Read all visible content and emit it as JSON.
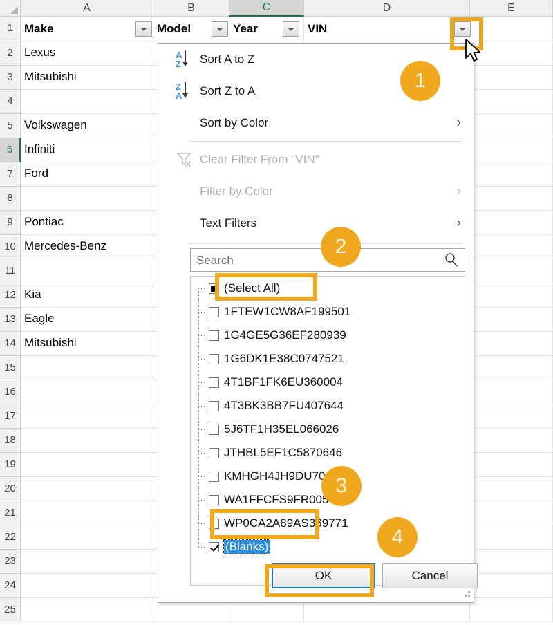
{
  "grid": {
    "columns": [
      "A",
      "B",
      "C",
      "D",
      "E"
    ],
    "active_column": "C",
    "active_row": 6,
    "row_numbers": [
      1,
      2,
      3,
      4,
      5,
      6,
      7,
      8,
      9,
      10,
      11,
      12,
      13,
      14,
      15,
      16,
      17,
      18,
      19,
      20,
      21,
      22,
      23,
      24,
      25
    ],
    "headers": {
      "a": "Make",
      "b": "Model",
      "c": "Year",
      "d": "VIN"
    },
    "column_a_values": [
      "Lexus",
      "Mitsubishi",
      "",
      "Volkswagen",
      "Infiniti",
      "Ford",
      "",
      "Pontiac",
      "Mercedes-Benz",
      "",
      "Kia",
      "Eagle",
      "Mitsubishi"
    ]
  },
  "filter_menu": {
    "sort_a_to_z": "Sort A to Z",
    "sort_z_to_a": "Sort Z to A",
    "sort_by_color": "Sort by Color",
    "clear_filter": "Clear Filter From \"VIN\"",
    "filter_by_color": "Filter by Color",
    "text_filters": "Text Filters",
    "submenu_arrow": "›",
    "search": {
      "placeholder": "Search",
      "value": "",
      "icon": "search-icon"
    },
    "list": [
      {
        "label": "(Select All)",
        "state": "partial",
        "selected": false
      },
      {
        "label": "1FTEW1CW8AF199501",
        "state": "unchecked",
        "selected": false
      },
      {
        "label": "1G4GE5G36EF280939",
        "state": "unchecked",
        "selected": false
      },
      {
        "label": "1G6DK1E38C0747521",
        "state": "unchecked",
        "selected": false
      },
      {
        "label": "4T1BF1FK6EU360004",
        "state": "unchecked",
        "selected": false
      },
      {
        "label": "4T3BK3BB7FU407644",
        "state": "unchecked",
        "selected": false
      },
      {
        "label": "5J6TF1H35EL066026",
        "state": "unchecked",
        "selected": false
      },
      {
        "label": "JTHBL5EF1C5870646",
        "state": "unchecked",
        "selected": false
      },
      {
        "label": "KMHGH4JH9DU700878",
        "state": "unchecked",
        "selected": false
      },
      {
        "label": "WA1FFCFS9FR005965",
        "state": "unchecked",
        "selected": false
      },
      {
        "label": "WP0CA2A89AS369771",
        "state": "unchecked",
        "selected": false
      },
      {
        "label": "(Blanks)",
        "state": "checked",
        "selected": true
      }
    ],
    "ok_label": "OK",
    "cancel_label": "Cancel"
  },
  "annotations": {
    "accent_color": "#F0A81E",
    "badges": [
      {
        "number": "1"
      },
      {
        "number": "2"
      },
      {
        "number": "3"
      },
      {
        "number": "4"
      }
    ]
  }
}
